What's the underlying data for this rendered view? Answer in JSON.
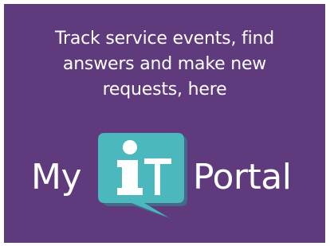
{
  "banner": {
    "background_color": "#5f3a7c",
    "tagline_lines": [
      "Track service events, find",
      "answers and make new",
      "requests, here"
    ],
    "logo": {
      "prefix": "My",
      "badge_text_i": "i",
      "badge_text_t": "T",
      "suffix": "Portal",
      "badge_color": "#4bb8bd",
      "badge_shadow_color": "#2f8f96",
      "icon": "speech-bubble-icon"
    }
  }
}
